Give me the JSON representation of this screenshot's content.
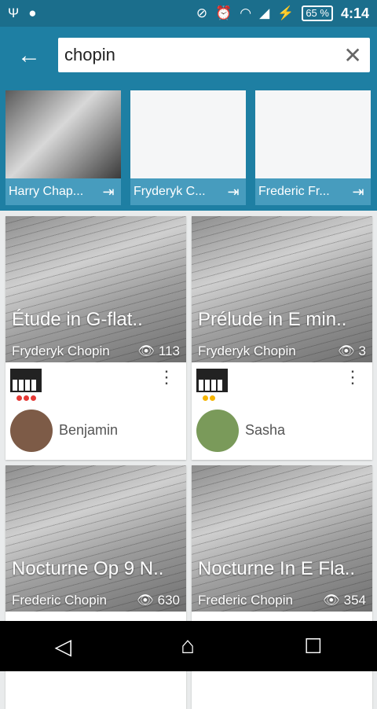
{
  "status_bar": {
    "battery": "65 %",
    "time": "4:14"
  },
  "search": {
    "value": "chopin"
  },
  "artists": [
    {
      "name": "Harry Chap...",
      "has_photo": true
    },
    {
      "name": "Fryderyk C...",
      "has_photo": false
    },
    {
      "name": "Frederic Fr...",
      "has_photo": false
    }
  ],
  "cards": [
    {
      "title": "Étude in G-flat..",
      "artist": "Fryderyk Chopin",
      "views": "113",
      "dots": [
        "#e53935",
        "#e53935",
        "#e53935"
      ],
      "user": "Benjamin",
      "avatar_color": "#7d5b47"
    },
    {
      "title": "Prélude in E min..",
      "artist": "Fryderyk Chopin",
      "views": "3",
      "dots": [
        "#f5b400",
        "#f5b400"
      ],
      "user": "Sasha",
      "avatar_color": "#7a9a5a"
    },
    {
      "title": "Nocturne Op 9 N..",
      "artist": "Frederic Chopin",
      "views": "630"
    },
    {
      "title": "Nocturne In E Fla..",
      "artist": "Frederic Chopin",
      "views": "354"
    }
  ]
}
